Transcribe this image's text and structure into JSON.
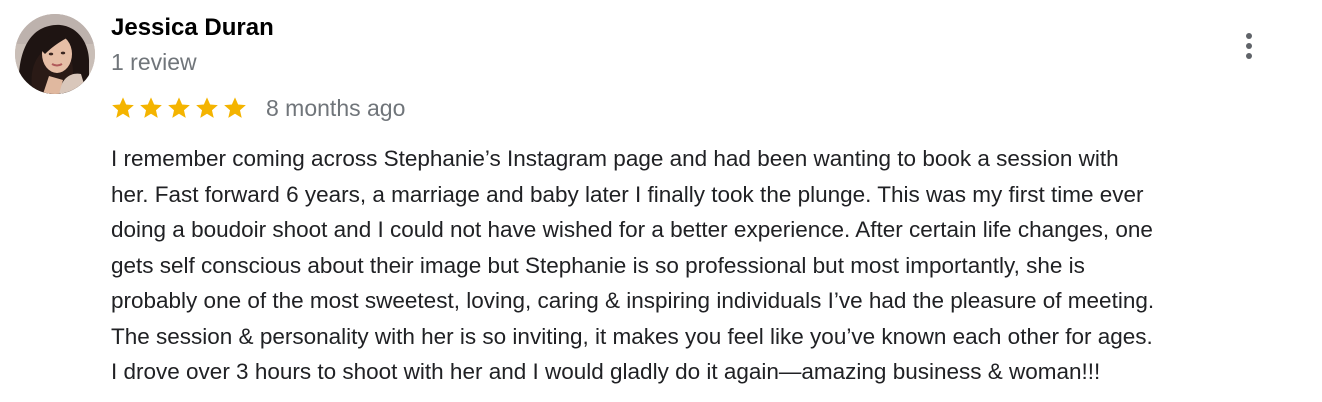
{
  "review": {
    "author_name": "Jessica Duran",
    "review_count": "1 review",
    "rating": 5,
    "rating_max": 5,
    "date": "8 months ago",
    "star_color": "#f4b400",
    "text_lines": [
      "I remember coming across Stephanie’s Instagram page and had been wanting to book a session with",
      "her. Fast forward 6 years, a marriage and baby later I finally took the plunge. This was my first time ever",
      "doing a boudoir shoot and I could not have wished for a better experience. After certain life changes, one",
      "gets self conscious about their image but Stephanie is so professional but most importantly, she is",
      "probably one of the most sweetest, loving, caring & inspiring individuals I’ve had the pleasure of meeting.",
      "The session & personality with her is so inviting, it makes you feel like you’ve known each other for ages.",
      "I drove over 3 hours to shoot with her and I would gladly do it again—amazing business & woman!!!"
    ]
  },
  "icons": {
    "more": "more-vert-icon",
    "star": "star-icon"
  }
}
